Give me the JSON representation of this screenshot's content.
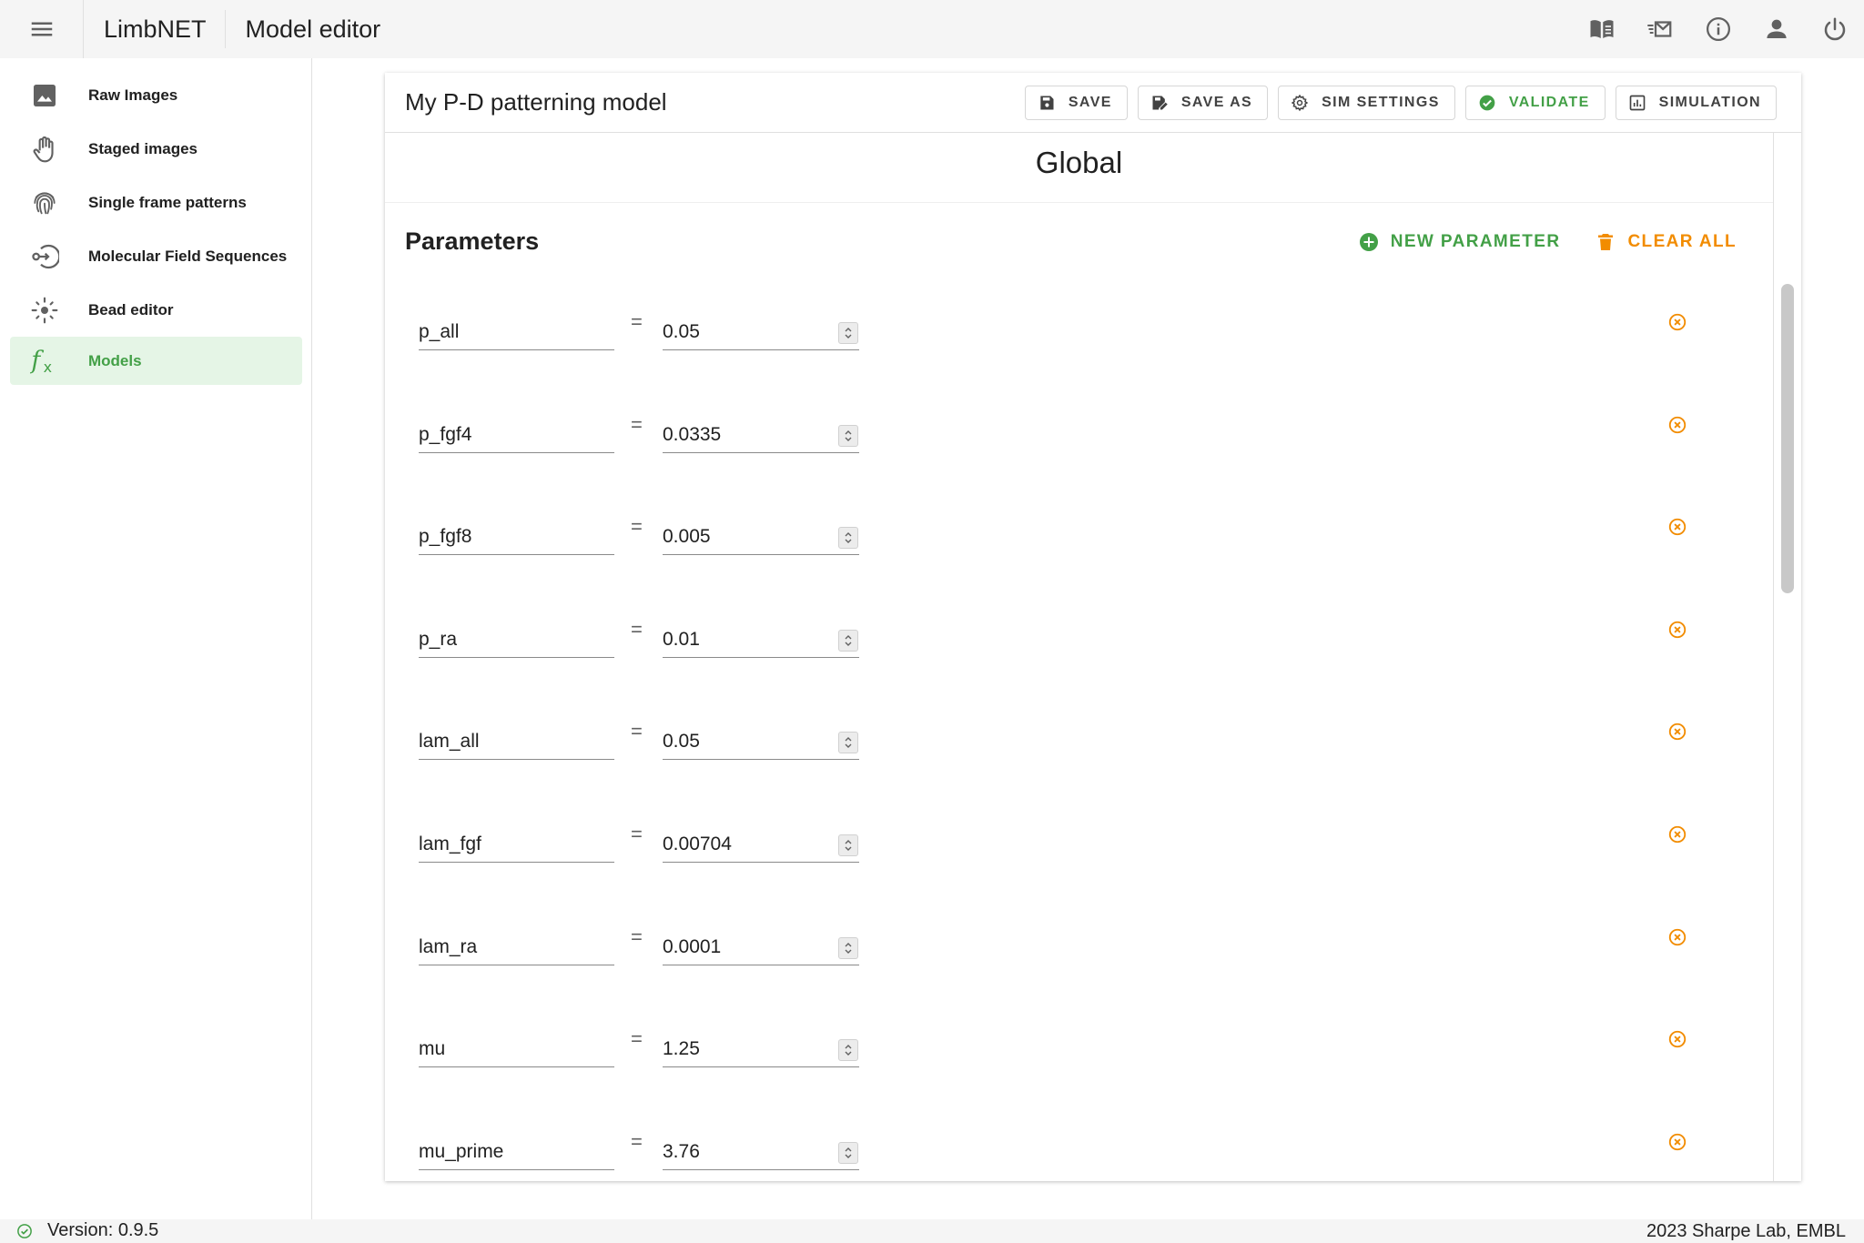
{
  "app": {
    "brand": "LimbNET",
    "page_title": "Model editor"
  },
  "appbar_icons": [
    "book-open-icon",
    "email-fast-icon",
    "info-icon",
    "account-icon",
    "power-icon"
  ],
  "sidebar": {
    "items": [
      {
        "label": "Raw Images",
        "icon": "image-icon",
        "active": false
      },
      {
        "label": "Staged images",
        "icon": "hand-icon",
        "active": false
      },
      {
        "label": "Single frame patterns",
        "icon": "fingerprint-icon",
        "active": false
      },
      {
        "label": "Molecular Field Sequences",
        "icon": "sequence-icon",
        "active": false
      },
      {
        "label": "Bead editor",
        "icon": "bead-icon",
        "active": false
      },
      {
        "label": "Models",
        "icon": "function-icon",
        "active": true
      }
    ]
  },
  "model": {
    "name": "My P-D patterning model"
  },
  "toolbar": {
    "save": "SAVE",
    "save_as": "SAVE AS",
    "sim_settings": "SIM SETTINGS",
    "validate": "VALIDATE",
    "simulation": "SIMULATION"
  },
  "section": {
    "title": "Global"
  },
  "parameters": {
    "title": "Parameters",
    "new_label": "NEW PARAMETER",
    "clear_label": "CLEAR ALL",
    "rows": [
      {
        "name": "p_all",
        "value": "0.05"
      },
      {
        "name": "p_fgf4",
        "value": "0.0335"
      },
      {
        "name": "p_fgf8",
        "value": "0.005"
      },
      {
        "name": "p_ra",
        "value": "0.01"
      },
      {
        "name": "lam_all",
        "value": "0.05"
      },
      {
        "name": "lam_fgf",
        "value": "0.00704"
      },
      {
        "name": "lam_ra",
        "value": "0.0001"
      },
      {
        "name": "mu",
        "value": "1.25"
      },
      {
        "name": "mu_prime",
        "value": "3.76"
      }
    ]
  },
  "colors": {
    "accent_green": "#43a047",
    "warning_orange": "#f28c00",
    "active_bg": "#e5f5e6"
  },
  "footer": {
    "version": "Version: 0.9.5",
    "copyright": "2023 Sharpe Lab, EMBL"
  }
}
